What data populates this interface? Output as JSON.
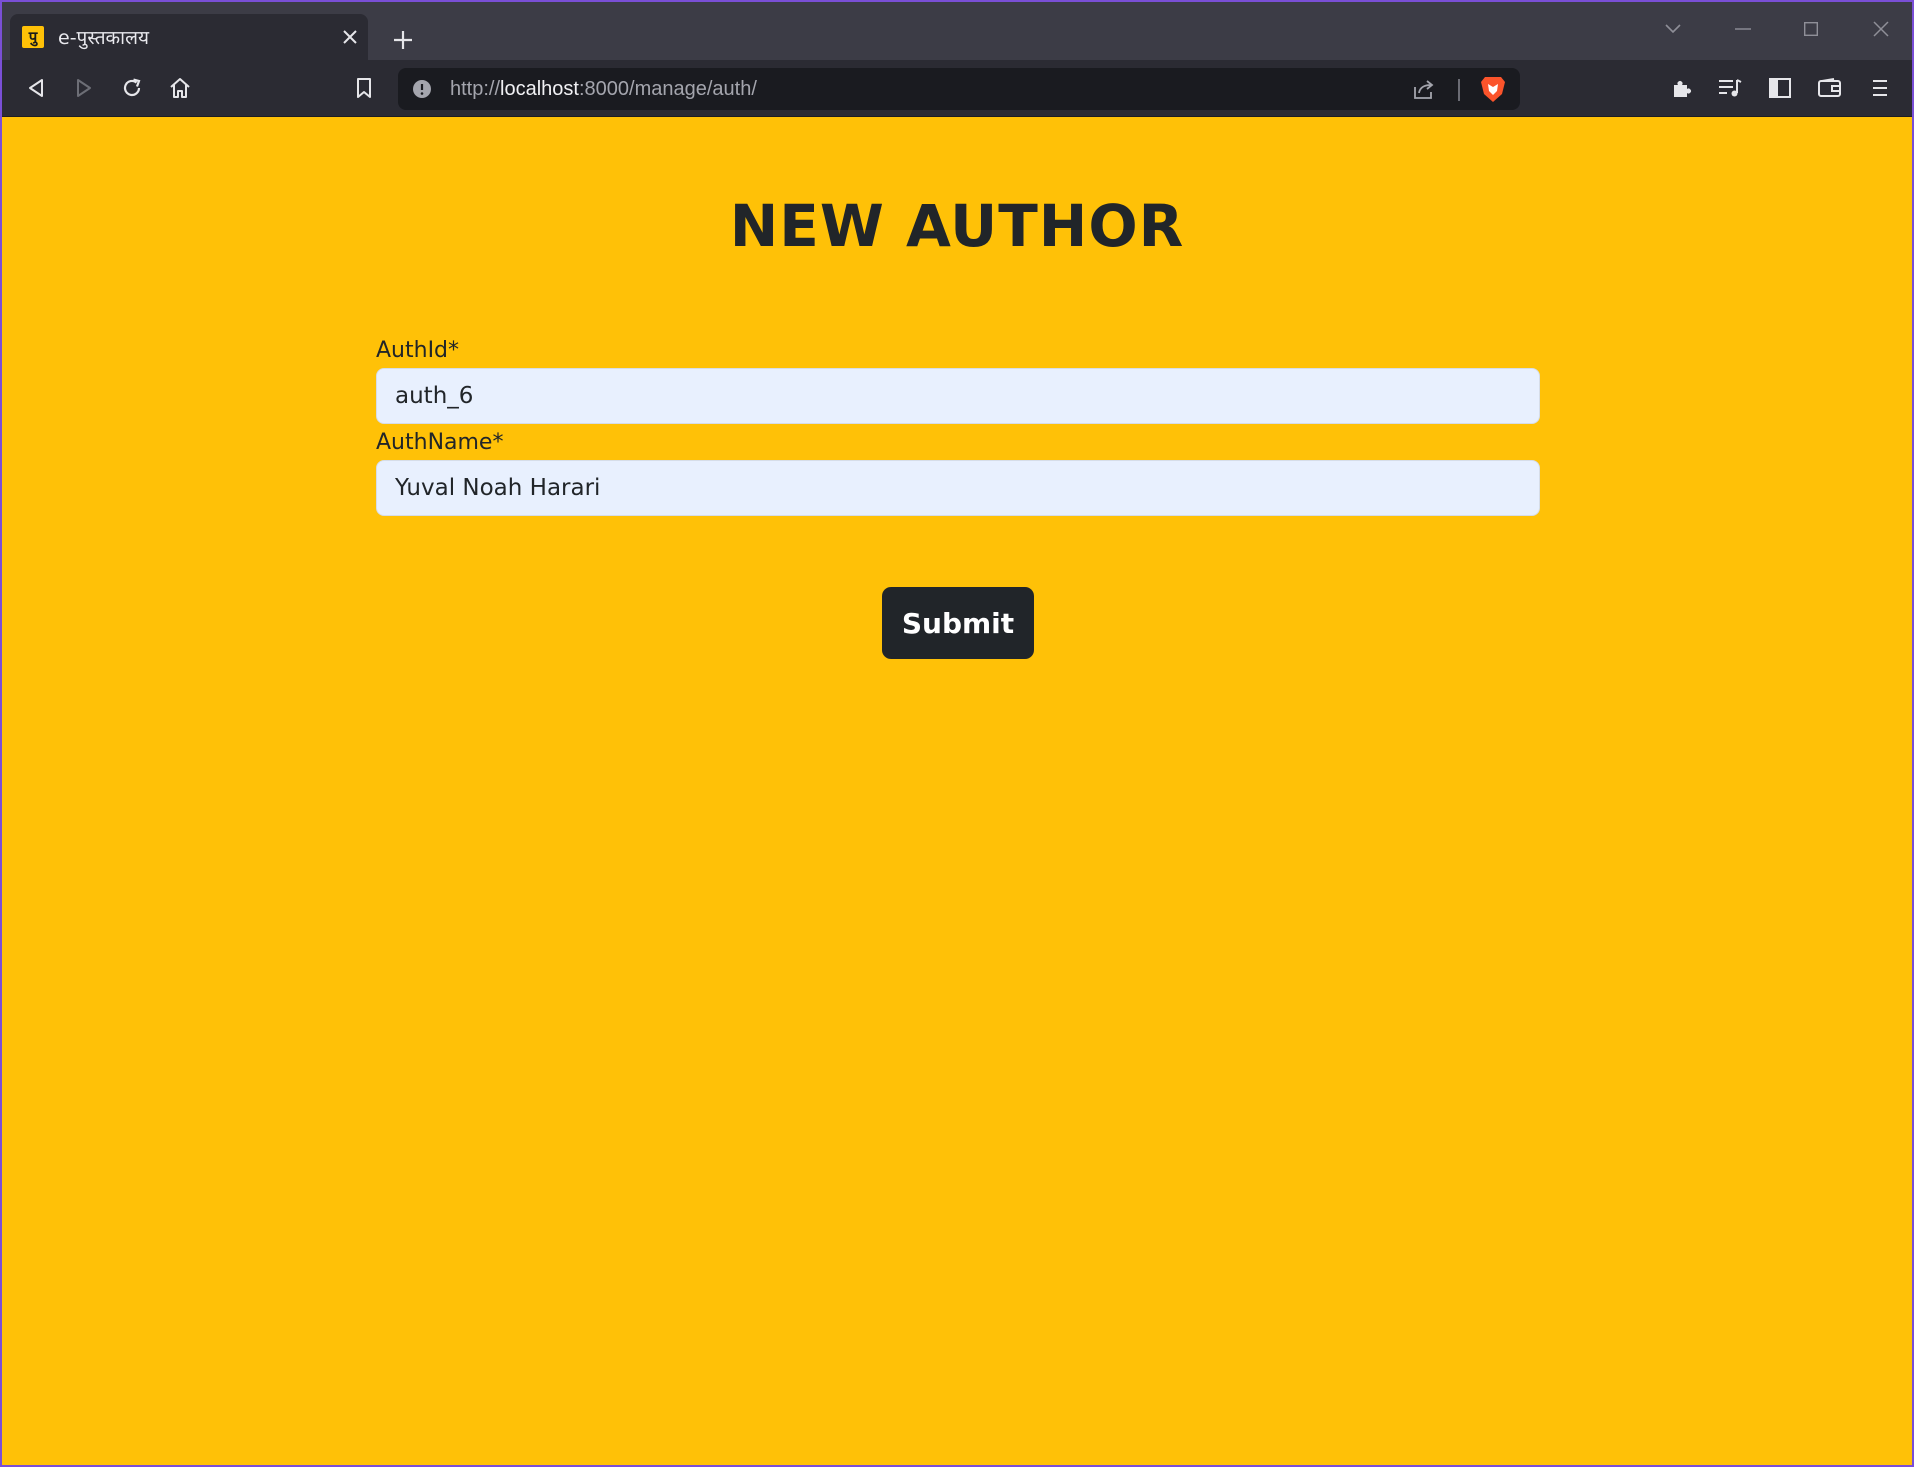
{
  "browser": {
    "tab": {
      "favicon_glyph": "पु",
      "title": "e-पुस्तकालय"
    },
    "url": {
      "scheme": "http://",
      "host": "localhost",
      "rest": ":8000/manage/auth/"
    }
  },
  "colors": {
    "page_background": "#ffc107",
    "button_background": "#212529",
    "input_background": "#e8f0fe",
    "browser_chrome": "#2b2b33"
  },
  "form": {
    "heading": "NEW AUTHOR",
    "fields": [
      {
        "label": "AuthId*",
        "value": "auth_6"
      },
      {
        "label": "AuthName*",
        "value": "Yuval Noah Harari"
      }
    ],
    "submit_label": "Submit"
  },
  "icons": [
    "close-icon",
    "plus-icon",
    "chevron-down-icon",
    "minimize-icon",
    "maximize-icon",
    "back-icon",
    "forward-icon",
    "reload-icon",
    "home-icon",
    "bookmark-icon",
    "info-icon",
    "share-icon",
    "brave-lion-icon",
    "extensions-icon",
    "playlist-icon",
    "sidebar-icon",
    "wallet-icon",
    "menu-icon"
  ]
}
